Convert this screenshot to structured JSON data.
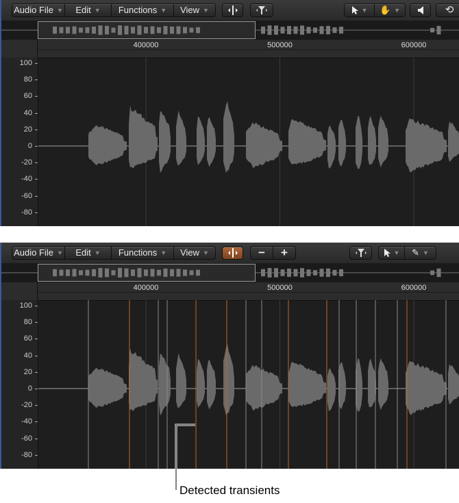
{
  "menus": [
    {
      "label": "Audio File"
    },
    {
      "label": "Edit"
    },
    {
      "label": "Functions"
    },
    {
      "label": "View"
    }
  ],
  "ruler": {
    "ticks": [
      {
        "value": 400000,
        "label": "400000"
      },
      {
        "value": 500000,
        "label": "500000"
      },
      {
        "value": 600000,
        "label": "600000"
      }
    ]
  },
  "yaxis": {
    "ticks": [
      "100",
      "80",
      "60",
      "40",
      "20",
      "0",
      "-20",
      "-40",
      "-60",
      "-80"
    ]
  },
  "top_panel": {
    "tools": [
      "transient-edit-mode-icon",
      "strip-silence-icon",
      "pointer-tool-icon",
      "hand-tool-icon",
      "speaker-icon",
      "loop-icon"
    ]
  },
  "bottom_panel": {
    "transient_mode_active": true,
    "minus": "−",
    "plus": "+",
    "tools": [
      "transient-edit-mode-icon",
      "minus-icon",
      "plus-icon",
      "strip-silence-icon",
      "pointer-tool-icon",
      "pencil-tool-icon"
    ]
  },
  "colors": {
    "transient": "#b8692e",
    "transient_alt": "#8a8a8a",
    "waveform": "#6a6a6a",
    "active": "#a85f30"
  },
  "caption": "Detected transients"
}
